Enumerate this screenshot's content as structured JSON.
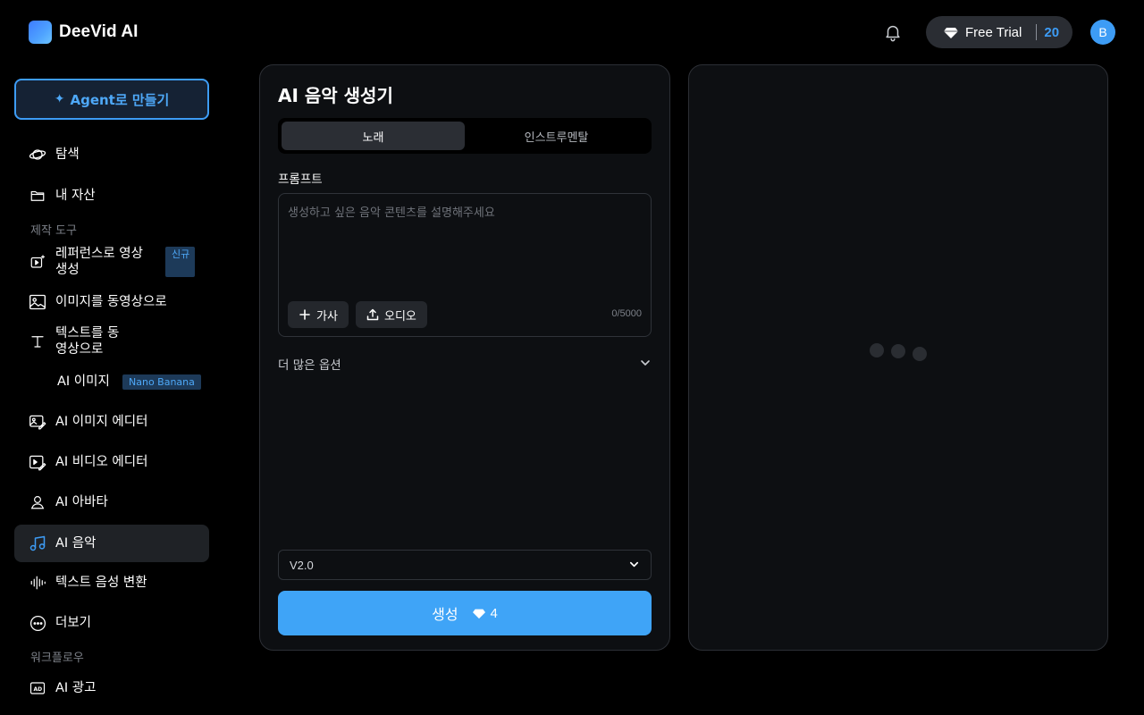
{
  "header": {
    "brand": "DeeVid AI",
    "trial_label": "Free Trial",
    "credits": "20",
    "avatar_initial": "B"
  },
  "sidebar": {
    "agent_button": "Agent로 만들기",
    "items": [
      {
        "label": "탐색",
        "icon": "planet-icon"
      },
      {
        "label": "내 자산",
        "icon": "folder-icon"
      },
      {
        "label": "레퍼런스로 영상 생성",
        "icon": "video-plus-icon"
      },
      {
        "label": "이미지를 동영상으로",
        "icon": "image-icon"
      },
      {
        "label": "텍스트를 동영상으로",
        "icon": "text-icon"
      },
      {
        "label": "AI 이미지",
        "icon": ""
      },
      {
        "label": "AI 이미지 에디터",
        "icon": "image-edit-icon"
      },
      {
        "label": "AI 비디오 에디터",
        "icon": "video-edit-icon"
      },
      {
        "label": "AI 아바타",
        "icon": "user-icon"
      },
      {
        "label": "AI 음악",
        "icon": "music-icon"
      },
      {
        "label": "텍스트 음성 변환",
        "icon": "waveform-icon"
      },
      {
        "label": "더보기",
        "icon": "more-icon"
      },
      {
        "label": "AI 광고",
        "icon": "ad-icon"
      }
    ],
    "section_tools": "제작 도구",
    "section_workflow": "워크플로우",
    "badge_new": "신규",
    "badge_nano": "Nano Banana",
    "active_item": "AI 음악",
    "accent_color": "#3d9cf5"
  },
  "generator": {
    "title": "AI 음악 생성기",
    "tabs": [
      "노래",
      "인스트루멘탈"
    ],
    "selected_tab": "노래",
    "prompt_label": "프롬프트",
    "prompt_value": "",
    "prompt_placeholder": "생성하고 싶은 음악 콘텐츠를 설명해주세요",
    "lyrics_chip": "가사",
    "audio_chip": "오디오",
    "char_count": "0/5000",
    "more_options": "더 많은 옵션",
    "version": "V2.0",
    "generate_label": "생성",
    "generate_cost": "4"
  },
  "preview": {
    "state": "loading"
  }
}
